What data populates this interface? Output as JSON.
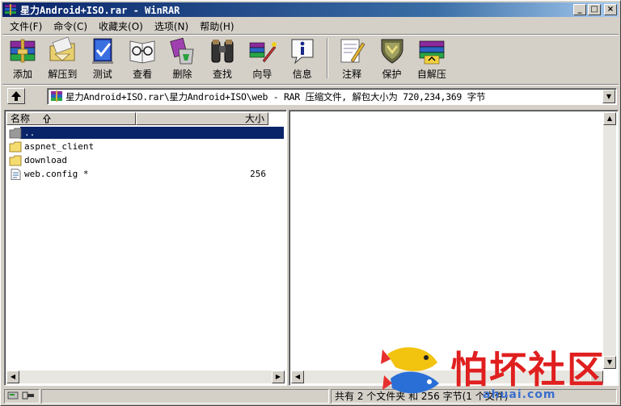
{
  "window": {
    "title": "星力Android+ISO.rar - WinRAR",
    "controls": [
      "_",
      "□",
      "×"
    ]
  },
  "menu": [
    {
      "label": "文件(F)"
    },
    {
      "label": "命令(C)"
    },
    {
      "label": "收藏夹(O)"
    },
    {
      "label": "选项(N)"
    },
    {
      "label": "帮助(H)"
    }
  ],
  "toolbar": [
    {
      "label": "添加",
      "icon": "books-add-icon"
    },
    {
      "label": "解压到",
      "icon": "extract-folder-icon"
    },
    {
      "label": "测试",
      "icon": "test-book-icon"
    },
    {
      "label": "查看",
      "icon": "view-glasses-icon"
    },
    {
      "label": "删除",
      "icon": "delete-recycle-icon"
    },
    {
      "label": "查找",
      "icon": "binoculars-icon"
    },
    {
      "label": "向导",
      "icon": "wizard-icon"
    },
    {
      "label": "信息",
      "icon": "info-icon"
    },
    {
      "label": "注释",
      "icon": "comment-pencil-icon"
    },
    {
      "label": "保护",
      "icon": "shield-icon"
    },
    {
      "label": "自解压",
      "icon": "sfx-books-icon"
    }
  ],
  "address": {
    "path": "星力Android+ISO.rar\\星力Android+ISO\\web - RAR 压缩文件, 解包大小为 720,234,369 字节"
  },
  "columns": {
    "name": "名称",
    "size": "大小"
  },
  "files": [
    {
      "name": "..",
      "size": "",
      "type": "folder-up",
      "selected": true
    },
    {
      "name": "aspnet_client",
      "size": "",
      "type": "folder",
      "selected": false
    },
    {
      "name": "download",
      "size": "",
      "type": "folder",
      "selected": false
    },
    {
      "name": "web.config *",
      "size": "256",
      "type": "file",
      "selected": false
    }
  ],
  "status": {
    "summary": "共有 2 个文件夹 和 256 字节(1 个文件)"
  },
  "watermark": {
    "text": "怕坏社区",
    "url": "ahuai.com"
  }
}
